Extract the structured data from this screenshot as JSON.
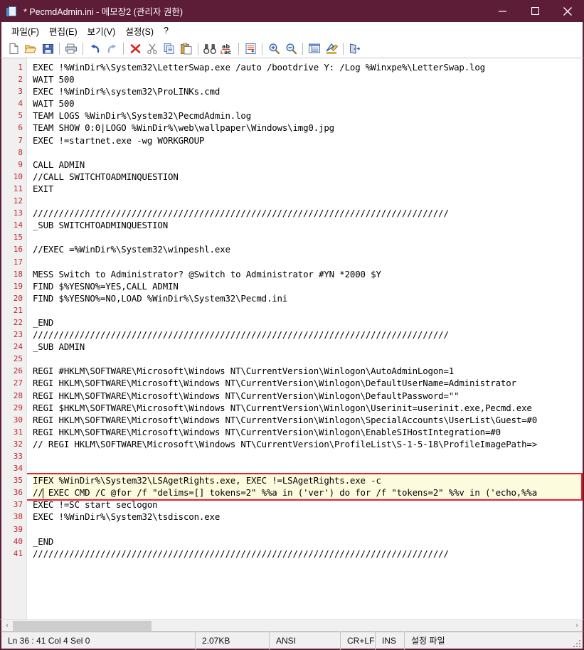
{
  "window": {
    "title": "* PecmdAdmin.ini - 메모장2 (관리자 권한)",
    "icon": "notepad-document-icon",
    "titlebar_color": "#5e1d36",
    "minimize_label": "최소화",
    "maximize_label": "최대화",
    "close_label": "닫기"
  },
  "menubar": {
    "items": [
      {
        "label": "파일(F)",
        "name": "menu-file"
      },
      {
        "label": "편집(E)",
        "name": "menu-edit"
      },
      {
        "label": "보기(V)",
        "name": "menu-view"
      },
      {
        "label": "설정(S)",
        "name": "menu-settings"
      },
      {
        "label": "?",
        "name": "menu-help"
      }
    ]
  },
  "toolbar": {
    "buttons": [
      {
        "name": "new-file-icon",
        "label": "새 파일"
      },
      {
        "name": "open-folder-icon",
        "label": "열기"
      },
      {
        "name": "save-icon",
        "label": "저장"
      },
      {
        "name": "print-icon",
        "label": "인쇄"
      },
      {
        "name": "undo-icon",
        "label": "실행 취소"
      },
      {
        "name": "redo-icon",
        "label": "다시 실행"
      },
      {
        "name": "delete-icon",
        "label": "삭제"
      },
      {
        "name": "cut-scissors-icon",
        "label": "잘라내기"
      },
      {
        "name": "copy-icon",
        "label": "복사"
      },
      {
        "name": "paste-icon",
        "label": "붙여넣기"
      },
      {
        "name": "find-binoculars-icon",
        "label": "찾기"
      },
      {
        "name": "replace-abc-icon",
        "label": "바꾸기"
      },
      {
        "name": "word-wrap-icon",
        "label": "자동 줄바꿈"
      },
      {
        "name": "zoom-in-icon",
        "label": "확대"
      },
      {
        "name": "zoom-out-icon",
        "label": "축소"
      },
      {
        "name": "line-numbers-icon",
        "label": "줄 번호"
      },
      {
        "name": "ruler-pencil-icon",
        "label": "눈금자"
      },
      {
        "name": "exit-door-icon",
        "label": "끝내기"
      }
    ]
  },
  "editor": {
    "line_number_color": "#c4242b",
    "gutter_color": "#f0f0f0",
    "highlight_color": "#fdfbdd",
    "redbox_color": "#ee1c25",
    "highlighted_lines": [
      35,
      36
    ],
    "caret_line": 36,
    "caret_col": 4,
    "lines": [
      {
        "n": 1,
        "text": "EXEC !%WinDir%\\System32\\LetterSwap.exe /auto /bootdrive Y: /Log %Winxpe%\\LetterSwap.log"
      },
      {
        "n": 2,
        "text": "WAIT 500"
      },
      {
        "n": 3,
        "text": "EXEC !%WinDir%\\system32\\ProLINKs.cmd"
      },
      {
        "n": 4,
        "text": "WAIT 500"
      },
      {
        "n": 5,
        "text": "TEAM LOGS %WinDir%\\System32\\PecmdAdmin.log"
      },
      {
        "n": 6,
        "text": "TEAM SHOW 0:0|LOGO %WinDir%\\web\\wallpaper\\Windows\\img0.jpg"
      },
      {
        "n": 7,
        "text": "EXEC !=startnet.exe -wg WORKGROUP"
      },
      {
        "n": 8,
        "text": ""
      },
      {
        "n": 9,
        "text": "CALL ADMIN"
      },
      {
        "n": 10,
        "text": "//CALL SWITCHTOADMINQUESTION"
      },
      {
        "n": 11,
        "text": "EXIT"
      },
      {
        "n": 12,
        "text": ""
      },
      {
        "n": 13,
        "text": "////////////////////////////////////////////////////////////////////////////////"
      },
      {
        "n": 14,
        "text": "_SUB SWITCHTOADMINQUESTION"
      },
      {
        "n": 15,
        "text": ""
      },
      {
        "n": 16,
        "text": "//EXEC =%WinDir%\\System32\\winpeshl.exe"
      },
      {
        "n": 17,
        "text": ""
      },
      {
        "n": 18,
        "text": "MESS Switch to Administrator? @Switch to Administrator #YN *2000 $Y"
      },
      {
        "n": 19,
        "text": "FIND $%YESNO%=YES,CALL ADMIN"
      },
      {
        "n": 20,
        "text": "FIND $%YESNO%=NO,LOAD %WinDir%\\System32\\Pecmd.ini"
      },
      {
        "n": 21,
        "text": ""
      },
      {
        "n": 22,
        "text": "_END"
      },
      {
        "n": 23,
        "text": "////////////////////////////////////////////////////////////////////////////////"
      },
      {
        "n": 24,
        "text": "_SUB ADMIN"
      },
      {
        "n": 25,
        "text": ""
      },
      {
        "n": 26,
        "text": "REGI #HKLM\\SOFTWARE\\Microsoft\\Windows NT\\CurrentVersion\\Winlogon\\AutoAdminLogon=1"
      },
      {
        "n": 27,
        "text": "REGI HKLM\\SOFTWARE\\Microsoft\\Windows NT\\CurrentVersion\\Winlogon\\DefaultUserName=Administrator"
      },
      {
        "n": 28,
        "text": "REGI HKLM\\SOFTWARE\\Microsoft\\Windows NT\\CurrentVersion\\Winlogon\\DefaultPassword=\"\""
      },
      {
        "n": 29,
        "text": "REGI $HKLM\\SOFTWARE\\Microsoft\\Windows NT\\CurrentVersion\\Winlogon\\Userinit=userinit.exe,Pecmd.exe"
      },
      {
        "n": 30,
        "text": "REGI HKLM\\SOFTWARE\\Microsoft\\Windows NT\\CurrentVersion\\Winlogon\\SpecialAccounts\\UserList\\Guest=#0"
      },
      {
        "n": 31,
        "text": "REGI HKLM\\SOFTWARE\\Microsoft\\Windows NT\\CurrentVersion\\Winlogon\\EnableSIHostIntegration=#0"
      },
      {
        "n": 32,
        "text": "// REGI HKLM\\SOFTWARE\\Microsoft\\Windows NT\\CurrentVersion\\ProfileList\\S-1-5-18\\ProfileImagePath=>"
      },
      {
        "n": 33,
        "text": ""
      },
      {
        "n": 34,
        "text": ""
      },
      {
        "n": 35,
        "text": "IFEX %WinDir%\\System32\\LSAgetRights.exe, EXEC !=LSAgetRights.exe -c"
      },
      {
        "n": 36,
        "text": "// EXEC CMD /C @for /f \"delims=[] tokens=2\" %%a in ('ver') do for /f \"tokens=2\" %%v in ('echo,%%a"
      },
      {
        "n": 37,
        "text": "EXEC !=SC start seclogon"
      },
      {
        "n": 38,
        "text": "EXEC !%WinDir%\\System32\\tsdiscon.exe"
      },
      {
        "n": 39,
        "text": ""
      },
      {
        "n": 40,
        "text": "_END"
      },
      {
        "n": 41,
        "text": "////////////////////////////////////////////////////////////////////////////////"
      }
    ]
  },
  "hscrollbar": {
    "left_arrow": "‹",
    "right_arrow": "›"
  },
  "statusbar": {
    "position": "Ln 36 : 41   Col 4   Sel 0",
    "size": "2.07KB",
    "encoding": "ANSI",
    "line_ending": "CR+LF",
    "insert_mode": "INS",
    "file_type": "설정 파일"
  }
}
